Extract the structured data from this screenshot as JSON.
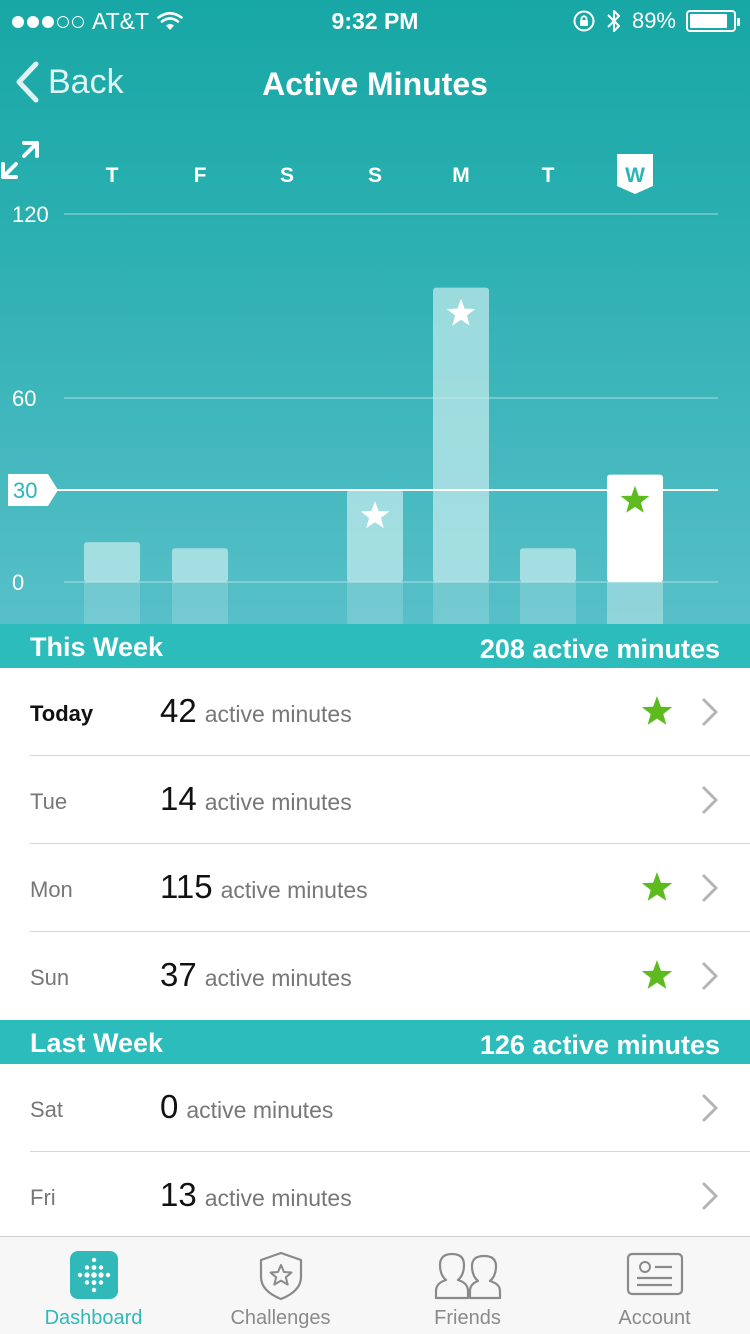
{
  "status_bar": {
    "carrier": "AT&T",
    "time": "9:32 PM",
    "battery": "89%",
    "signal_bars_filled": 3,
    "signal_bars_total": 5
  },
  "nav": {
    "back_label": "Back",
    "title": "Active Minutes"
  },
  "chart_data": {
    "type": "bar",
    "categories": [
      "T",
      "F",
      "S",
      "S",
      "M",
      "T",
      "W"
    ],
    "values": [
      13,
      11,
      0,
      30,
      96,
      11,
      35
    ],
    "goal_reached": [
      false,
      false,
      false,
      true,
      true,
      false,
      true
    ],
    "selected_index": 6,
    "y_ticks": [
      "120",
      "60",
      "0"
    ],
    "goal_label": "30",
    "goal": 30,
    "ylim": [
      0,
      120
    ],
    "bar_color": "#c8ecee",
    "selected_bar_color": "#ffffff",
    "star_color_selected": "#5dbb1f"
  },
  "this_week": {
    "label": "This Week",
    "total": "208 active minutes",
    "rows": [
      {
        "day": "Today",
        "value": "42",
        "unit": "active minutes",
        "star": true,
        "is_today": true
      },
      {
        "day": "Tue",
        "value": "14",
        "unit": "active minutes",
        "star": false,
        "is_today": false
      },
      {
        "day": "Mon",
        "value": "115",
        "unit": "active minutes",
        "star": true,
        "is_today": false
      },
      {
        "day": "Sun",
        "value": "37",
        "unit": "active minutes",
        "star": true,
        "is_today": false
      }
    ]
  },
  "last_week": {
    "label": "Last Week",
    "total": "126 active minutes",
    "rows": [
      {
        "day": "Sat",
        "value": "0",
        "unit": "active minutes",
        "star": false,
        "is_today": false
      },
      {
        "day": "Fri",
        "value": "13",
        "unit": "active minutes",
        "star": false,
        "is_today": false
      }
    ]
  },
  "tabs": [
    {
      "label": "Dashboard",
      "icon": "dashboard-icon",
      "active": true
    },
    {
      "label": "Challenges",
      "icon": "challenges-icon",
      "active": false
    },
    {
      "label": "Friends",
      "icon": "friends-icon",
      "active": false
    },
    {
      "label": "Account",
      "icon": "account-icon",
      "active": false
    }
  ],
  "colors": {
    "accent": "#2dbcbc",
    "star_green": "#5dbb1f",
    "tab_active": "#30b9b8"
  }
}
